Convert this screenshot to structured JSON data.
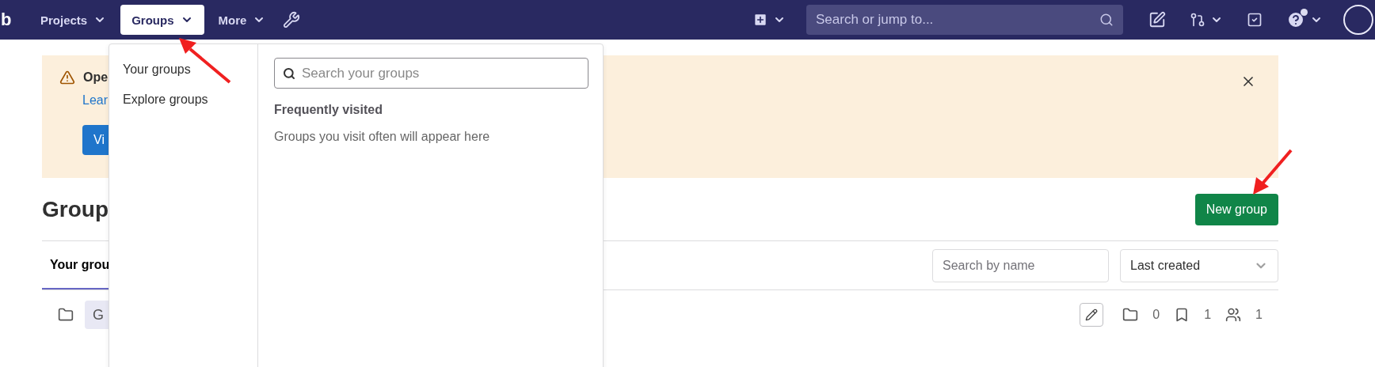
{
  "nav": {
    "logo": "b",
    "items": [
      {
        "label": "Projects",
        "selected": false
      },
      {
        "label": "Groups",
        "selected": true
      },
      {
        "label": "More",
        "selected": false
      }
    ],
    "search": {
      "placeholder": "Search or jump to..."
    }
  },
  "groups_menu": {
    "links": [
      "Your groups",
      "Explore groups"
    ],
    "search": {
      "placeholder": "Search your groups"
    },
    "heading": "Frequently visited",
    "empty_text": "Groups you visit often will appear here"
  },
  "alert": {
    "title": "Ope",
    "link": "Lear",
    "button": "Vi"
  },
  "page": {
    "title": "Group",
    "new_button": "New group",
    "tabs": [
      {
        "label": "Your grou",
        "selected": true
      }
    ],
    "filter": {
      "placeholder": "Search by name"
    },
    "sort": {
      "value": "Last created"
    },
    "rows": [
      {
        "avatar": "G",
        "subgroups": "0",
        "projects": "1",
        "members": "1"
      }
    ]
  }
}
